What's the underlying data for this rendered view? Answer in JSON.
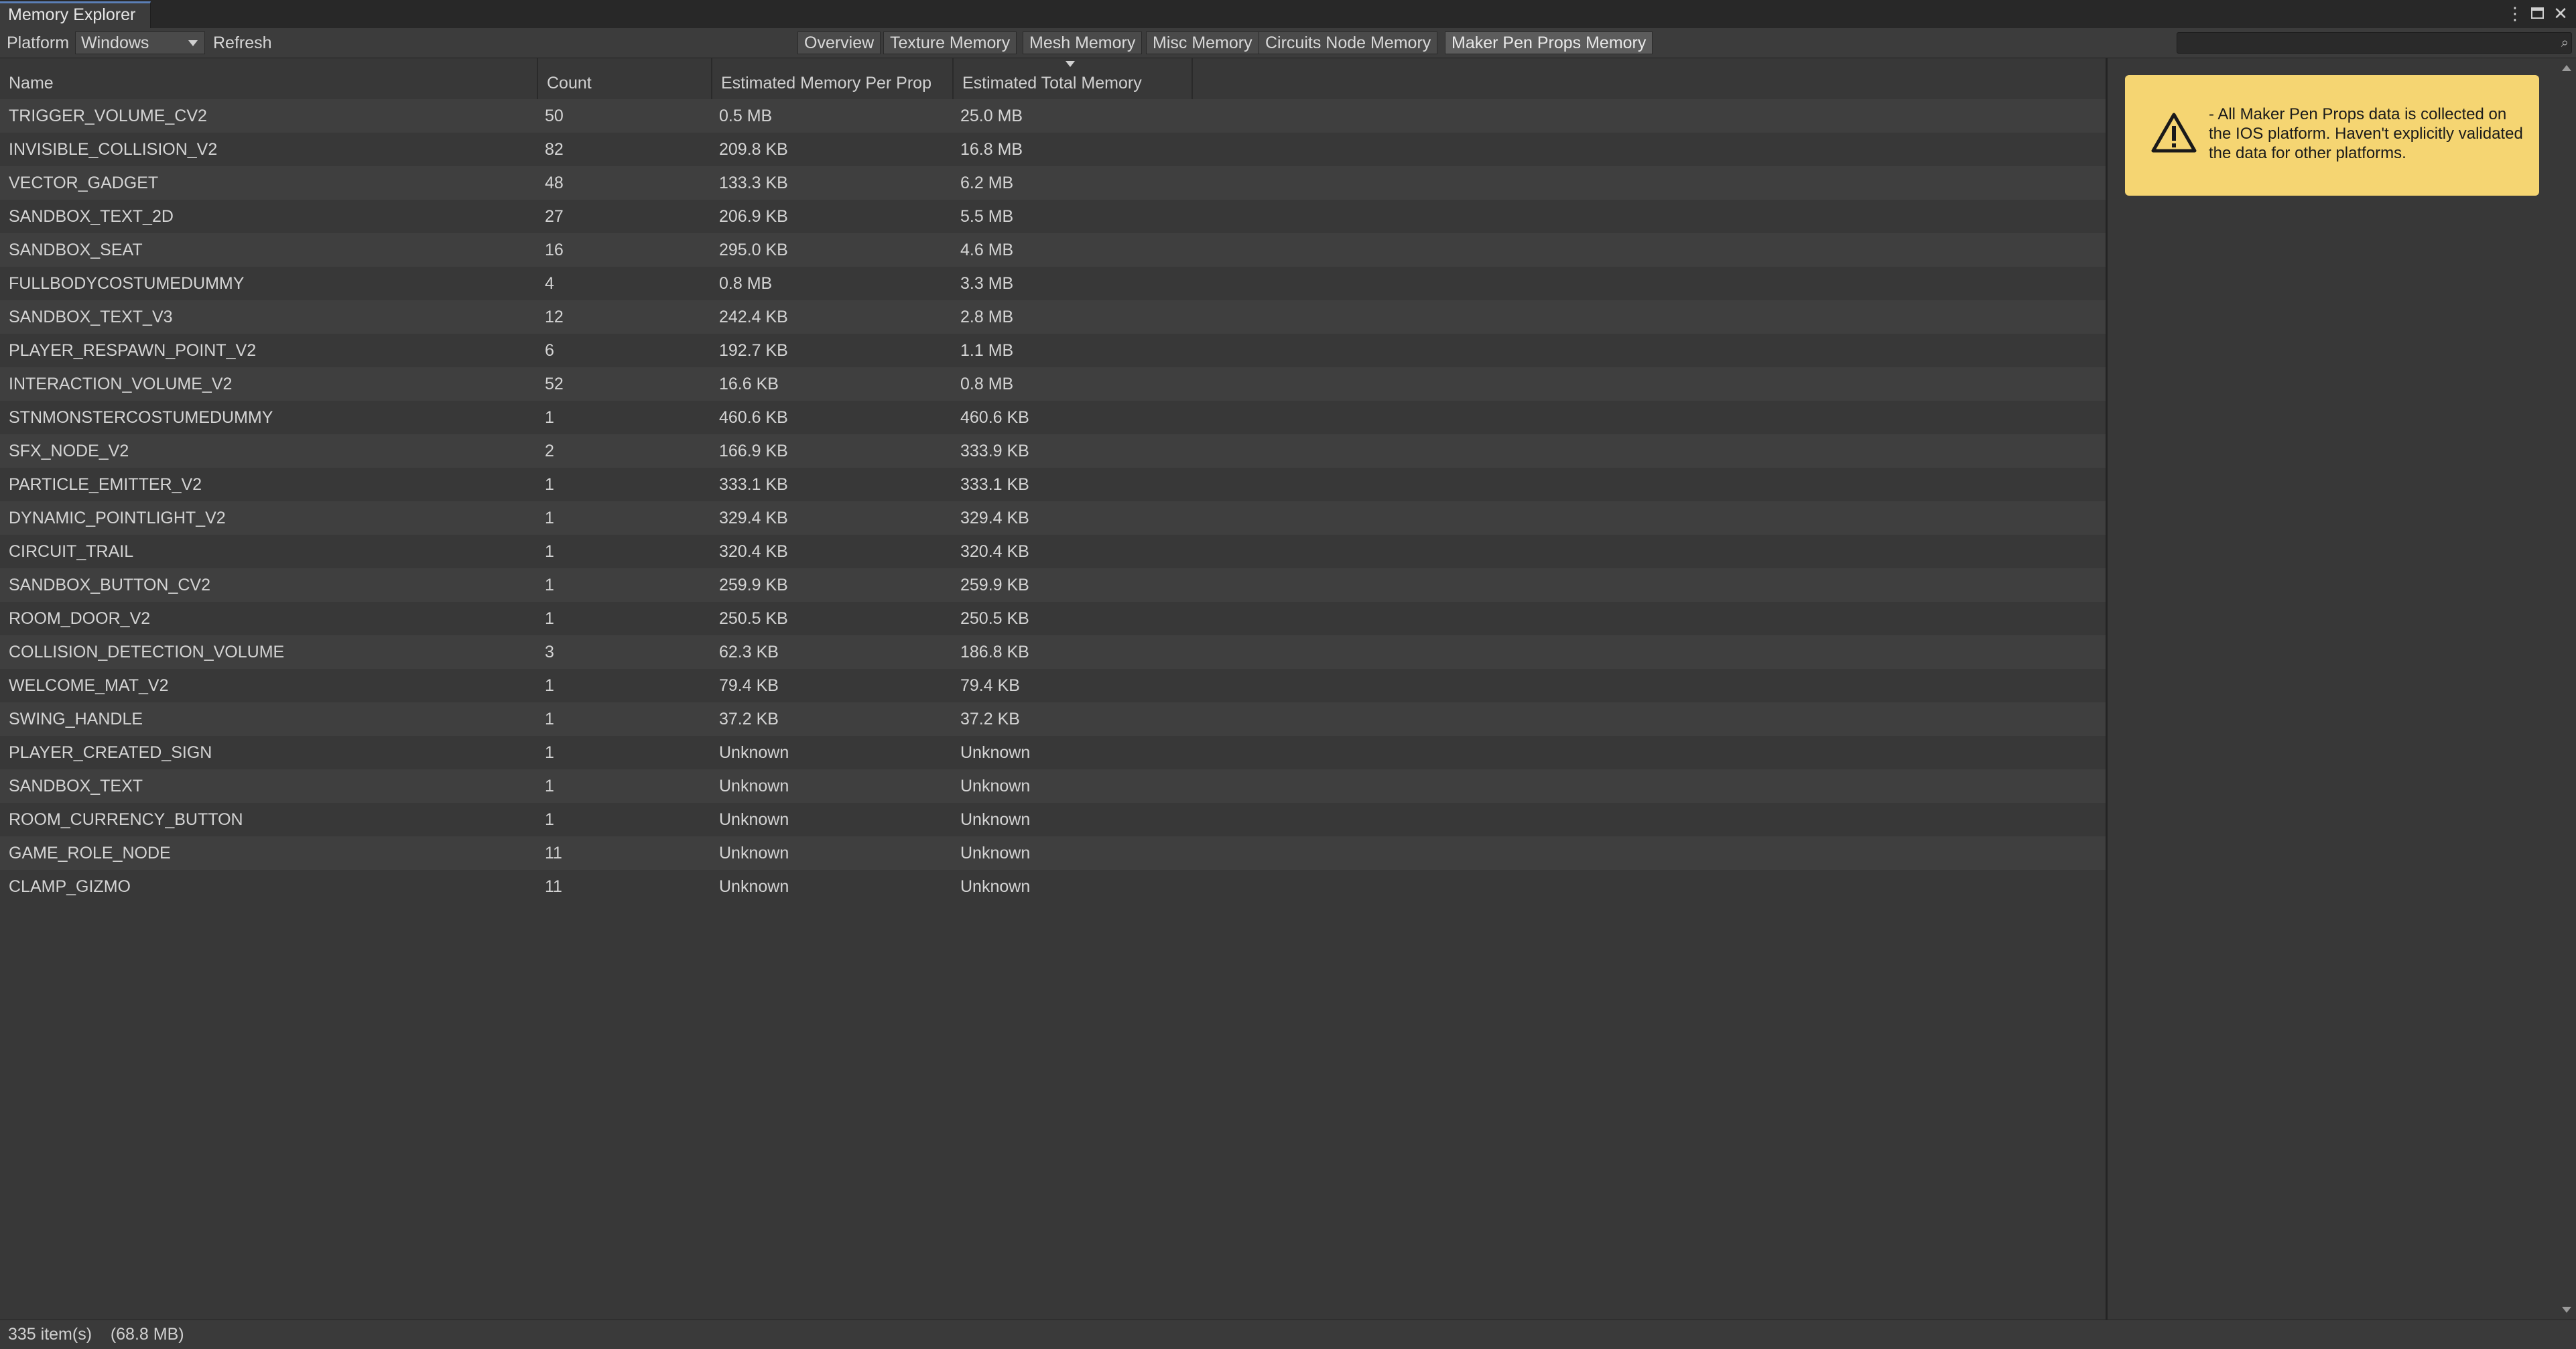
{
  "window": {
    "title": "Memory Explorer",
    "menu_icon": "kebab-menu-icon",
    "maximize_icon": "maximize-icon",
    "close_icon": "close-icon"
  },
  "toolbar": {
    "platform_label": "Platform",
    "platform_value": "Windows",
    "refresh_label": "Refresh",
    "tabs": [
      {
        "label": "Overview",
        "active": false
      },
      {
        "label": "Texture Memory",
        "active": false
      },
      {
        "label": "Mesh Memory",
        "active": false
      },
      {
        "label": "Misc Memory",
        "active": false
      },
      {
        "label": "Circuits Node Memory",
        "active": false
      },
      {
        "label": "Maker Pen Props Memory",
        "active": true
      }
    ],
    "search_value": ""
  },
  "table": {
    "columns": [
      "Name",
      "Count",
      "Estimated Memory Per Prop",
      "Estimated Total Memory"
    ],
    "sorted_column": "Estimated Total Memory",
    "rows": [
      {
        "name": "TRIGGER_VOLUME_CV2",
        "count": "50",
        "per": "0.5 MB",
        "total": "25.0 MB"
      },
      {
        "name": "INVISIBLE_COLLISION_V2",
        "count": "82",
        "per": "209.8 KB",
        "total": "16.8 MB"
      },
      {
        "name": "VECTOR_GADGET",
        "count": "48",
        "per": "133.3 KB",
        "total": "6.2 MB"
      },
      {
        "name": "SANDBOX_TEXT_2D",
        "count": "27",
        "per": "206.9 KB",
        "total": "5.5 MB"
      },
      {
        "name": "SANDBOX_SEAT",
        "count": "16",
        "per": "295.0 KB",
        "total": "4.6 MB"
      },
      {
        "name": "FULLBODYCOSTUMEDUMMY",
        "count": "4",
        "per": "0.8 MB",
        "total": "3.3 MB"
      },
      {
        "name": "SANDBOX_TEXT_V3",
        "count": "12",
        "per": "242.4 KB",
        "total": "2.8 MB"
      },
      {
        "name": "PLAYER_RESPAWN_POINT_V2",
        "count": "6",
        "per": "192.7 KB",
        "total": "1.1 MB"
      },
      {
        "name": "INTERACTION_VOLUME_V2",
        "count": "52",
        "per": "16.6 KB",
        "total": "0.8 MB"
      },
      {
        "name": "STNMONSTERCOSTUMEDUMMY",
        "count": "1",
        "per": "460.6 KB",
        "total": "460.6 KB"
      },
      {
        "name": "SFX_NODE_V2",
        "count": "2",
        "per": "166.9 KB",
        "total": "333.9 KB"
      },
      {
        "name": "PARTICLE_EMITTER_V2",
        "count": "1",
        "per": "333.1 KB",
        "total": "333.1 KB"
      },
      {
        "name": "DYNAMIC_POINTLIGHT_V2",
        "count": "1",
        "per": "329.4 KB",
        "total": "329.4 KB"
      },
      {
        "name": "CIRCUIT_TRAIL",
        "count": "1",
        "per": "320.4 KB",
        "total": "320.4 KB"
      },
      {
        "name": "SANDBOX_BUTTON_CV2",
        "count": "1",
        "per": "259.9 KB",
        "total": "259.9 KB"
      },
      {
        "name": "ROOM_DOOR_V2",
        "count": "1",
        "per": "250.5 KB",
        "total": "250.5 KB"
      },
      {
        "name": "COLLISION_DETECTION_VOLUME",
        "count": "3",
        "per": "62.3 KB",
        "total": "186.8 KB"
      },
      {
        "name": "WELCOME_MAT_V2",
        "count": "1",
        "per": "79.4 KB",
        "total": "79.4 KB"
      },
      {
        "name": "SWING_HANDLE",
        "count": "1",
        "per": "37.2 KB",
        "total": "37.2 KB"
      },
      {
        "name": "PLAYER_CREATED_SIGN",
        "count": "1",
        "per": "Unknown",
        "total": "Unknown"
      },
      {
        "name": "SANDBOX_TEXT",
        "count": "1",
        "per": "Unknown",
        "total": "Unknown"
      },
      {
        "name": "ROOM_CURRENCY_BUTTON",
        "count": "1",
        "per": "Unknown",
        "total": "Unknown"
      },
      {
        "name": "GAME_ROLE_NODE",
        "count": "11",
        "per": "Unknown",
        "total": "Unknown"
      },
      {
        "name": "CLAMP_GIZMO",
        "count": "11",
        "per": "Unknown",
        "total": "Unknown"
      }
    ]
  },
  "warning": {
    "icon": "warning-triangle-icon",
    "text": "- All Maker Pen Props data is collected on the IOS platform. Haven't explicitly validated the data for other platforms.",
    "background": "#f5d572"
  },
  "status": {
    "text": "335 item(s)    (68.8 MB)"
  },
  "colors": {
    "background": "#383838",
    "row_alt": "#3f3f3f",
    "accent": "#5b7fb6"
  }
}
